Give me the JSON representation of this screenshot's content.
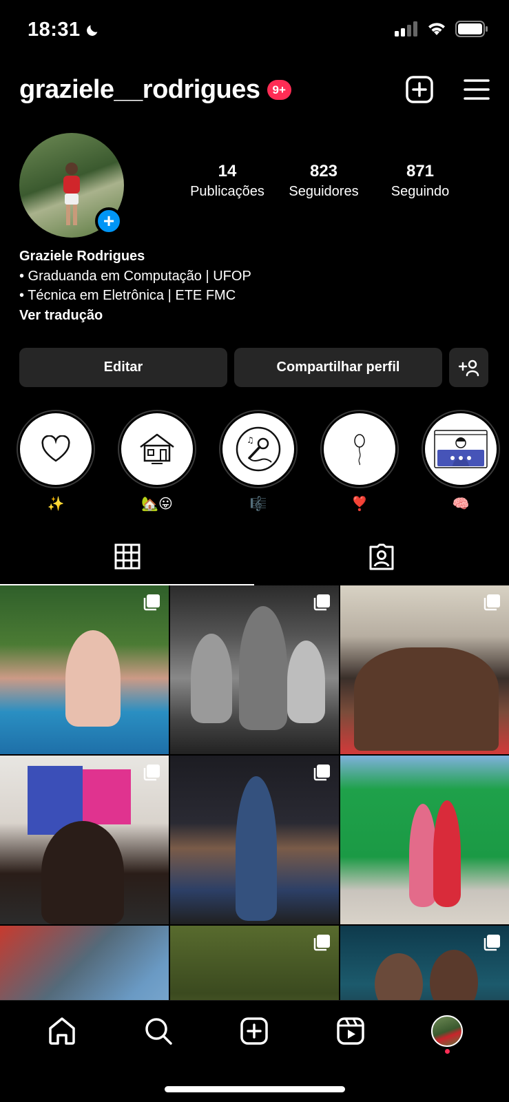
{
  "status_bar": {
    "time": "18:31",
    "icons": [
      "moon-icon",
      "signal-icon",
      "wifi-icon",
      "battery-icon"
    ]
  },
  "header": {
    "username": "graziele__rodrigues",
    "notification_badge": "9+",
    "icons": [
      "new-post-icon",
      "menu-icon"
    ]
  },
  "profile": {
    "stats": [
      {
        "value": "14",
        "label": "Publicações"
      },
      {
        "value": "823",
        "label": "Seguidores"
      },
      {
        "value": "871",
        "label": "Seguindo"
      }
    ],
    "name": "Graziele Rodrigues",
    "bio_lines": [
      "• Graduanda em Computação | UFOP",
      "• Técnica em Eletrônica | ETE FMC"
    ],
    "translate_link": "Ver tradução"
  },
  "buttons": {
    "edit": "Editar",
    "share": "Compartilhar perfil"
  },
  "highlights": [
    {
      "icon": "heart-icon",
      "label": "✨"
    },
    {
      "icon": "house-icon",
      "label": "🏡😛"
    },
    {
      "icon": "microphone-icon",
      "label": "🎼"
    },
    {
      "icon": "balloon-icon",
      "label": "❣️"
    },
    {
      "icon": "video-call-icon",
      "label": "🧠"
    }
  ],
  "tabs": [
    {
      "icon": "grid-icon",
      "active": true
    },
    {
      "icon": "tagged-icon",
      "active": false
    }
  ],
  "posts": [
    {
      "multi": true
    },
    {
      "multi": true
    },
    {
      "multi": true
    },
    {
      "multi": true
    },
    {
      "multi": true
    },
    {
      "multi": false
    },
    {
      "multi": false
    },
    {
      "multi": true
    },
    {
      "multi": true
    }
  ],
  "bottom_nav": [
    "home-icon",
    "search-icon",
    "create-icon",
    "reels-icon",
    "profile-avatar"
  ],
  "colors": {
    "background": "#000000",
    "badge": "#ff2d55",
    "accent_blue": "#0095f6",
    "button_bg": "#262626"
  }
}
